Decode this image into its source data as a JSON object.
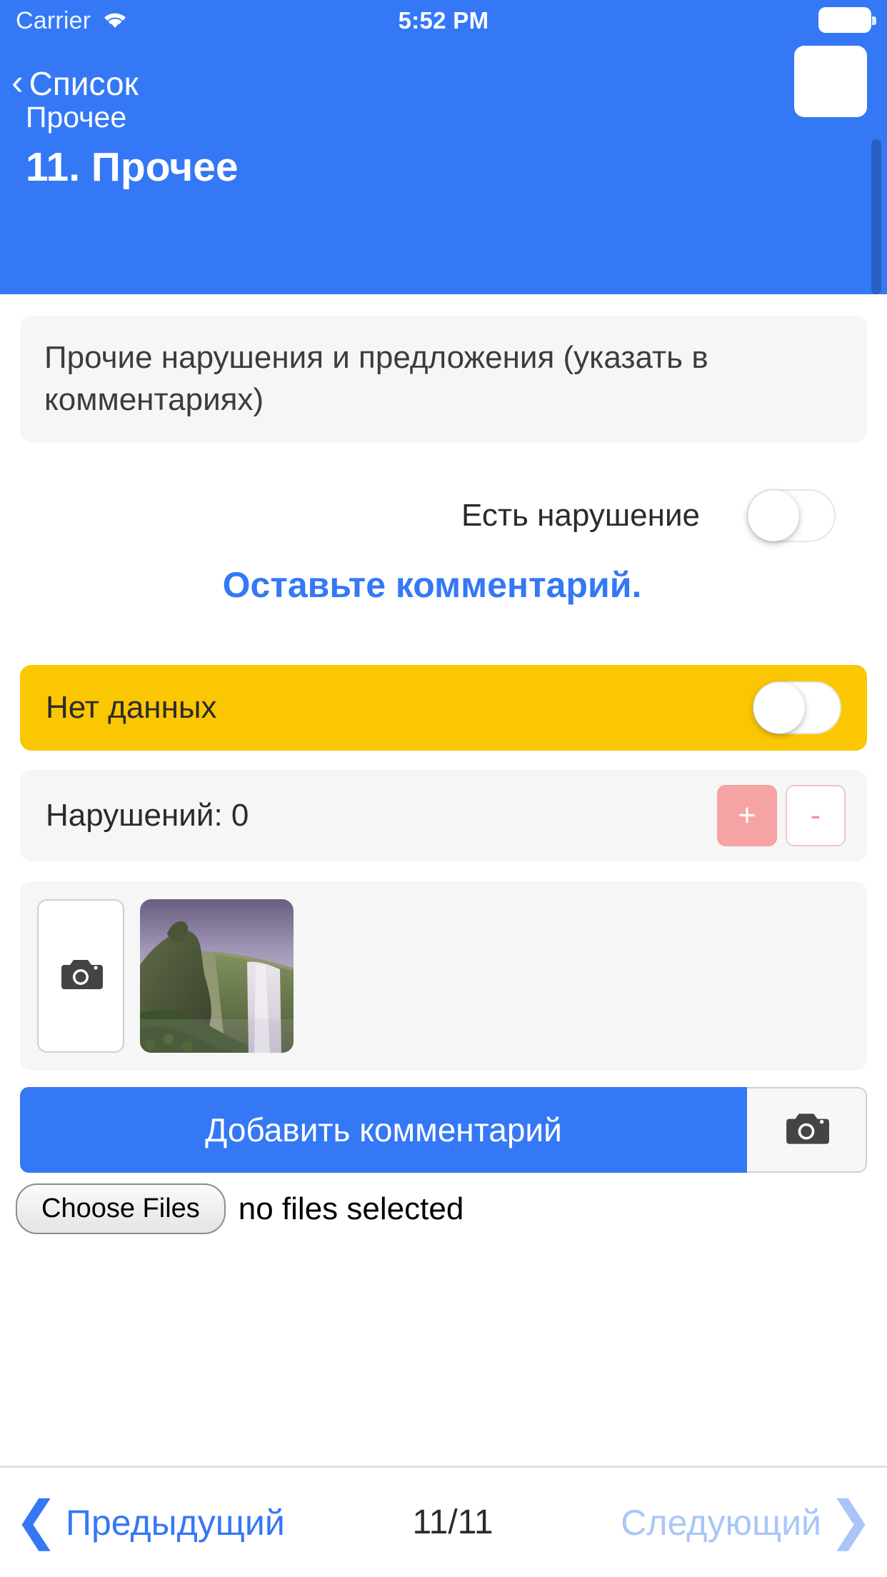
{
  "statusbar": {
    "carrier": "Carrier",
    "wifi_icon": "wifi-icon",
    "time": "5:52 PM",
    "battery_icon": "battery-full-icon"
  },
  "navbar": {
    "back_icon": "chevron-left-icon",
    "back_label": "Список",
    "action_square": "blank-square-button"
  },
  "header": {
    "breadcrumb": "Прочее",
    "title": "11. Прочее",
    "bg_color": "#3478f6"
  },
  "main": {
    "description": "Прочие нарушения и предложения (указать в комментариях)",
    "violation": {
      "label": "Есть нарушение",
      "toggle_state": "off"
    },
    "comment_prompt": "Оставьте комментарий.",
    "no_data": {
      "label": "Нет данных",
      "toggle_state": "off",
      "bg_color": "#fbc702"
    },
    "counter": {
      "label": "Нарушений: 0",
      "plus_label": "+",
      "minus_label": "-",
      "plus_color": "#f5a3a3",
      "minus_color": "#f09a9a"
    },
    "photos": {
      "add_icon": "camera-icon",
      "thumbnail_alt": "waterfall-photo"
    },
    "add_comment_label": "Добавить комментарий",
    "camera_button_icon": "camera-icon",
    "file_input": {
      "button_label": "Choose Files",
      "status": "no files selected"
    }
  },
  "footer": {
    "prev_icon": "chevron-left-icon",
    "prev_label": "Предыдущий",
    "counter": "11/11",
    "next_label": "Следующий",
    "next_icon": "chevron-right-icon",
    "prev_color": "#3478f6",
    "next_color": "#a9c6f7"
  }
}
